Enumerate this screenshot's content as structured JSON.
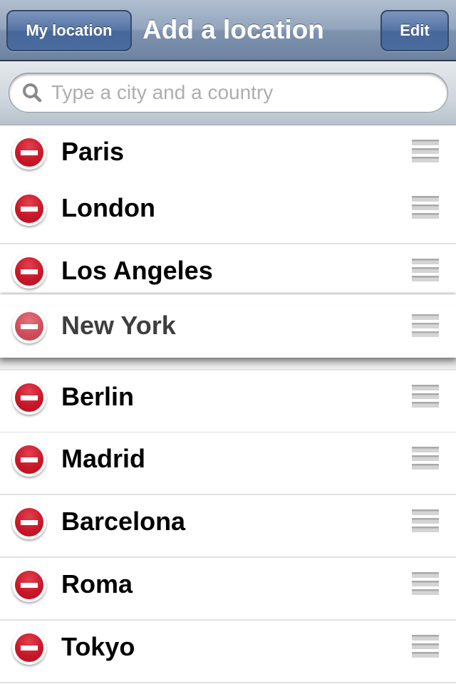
{
  "navbar": {
    "left_button": "My location",
    "title": "Add a location",
    "right_button": "Edit"
  },
  "search": {
    "placeholder": "Type a city and a country",
    "value": "",
    "icon": "search-icon"
  },
  "locations": [
    {
      "name": "Paris",
      "state": "normal"
    },
    {
      "name": "London",
      "state": "normal"
    },
    {
      "name": "Los Angeles",
      "state": "normal"
    },
    {
      "name": "New York",
      "state": "dragging"
    },
    {
      "name": "Berlin",
      "state": "normal"
    },
    {
      "name": "Madrid",
      "state": "normal"
    },
    {
      "name": "Barcelona",
      "state": "normal"
    },
    {
      "name": "Roma",
      "state": "normal"
    },
    {
      "name": "Tokyo",
      "state": "normal"
    }
  ],
  "icons": {
    "delete": "delete-minus-icon",
    "reorder": "reorder-grip-icon"
  },
  "colors": {
    "navbar": "#7f93ae",
    "button": "#4a6b9d",
    "delete": "#c8182a"
  }
}
